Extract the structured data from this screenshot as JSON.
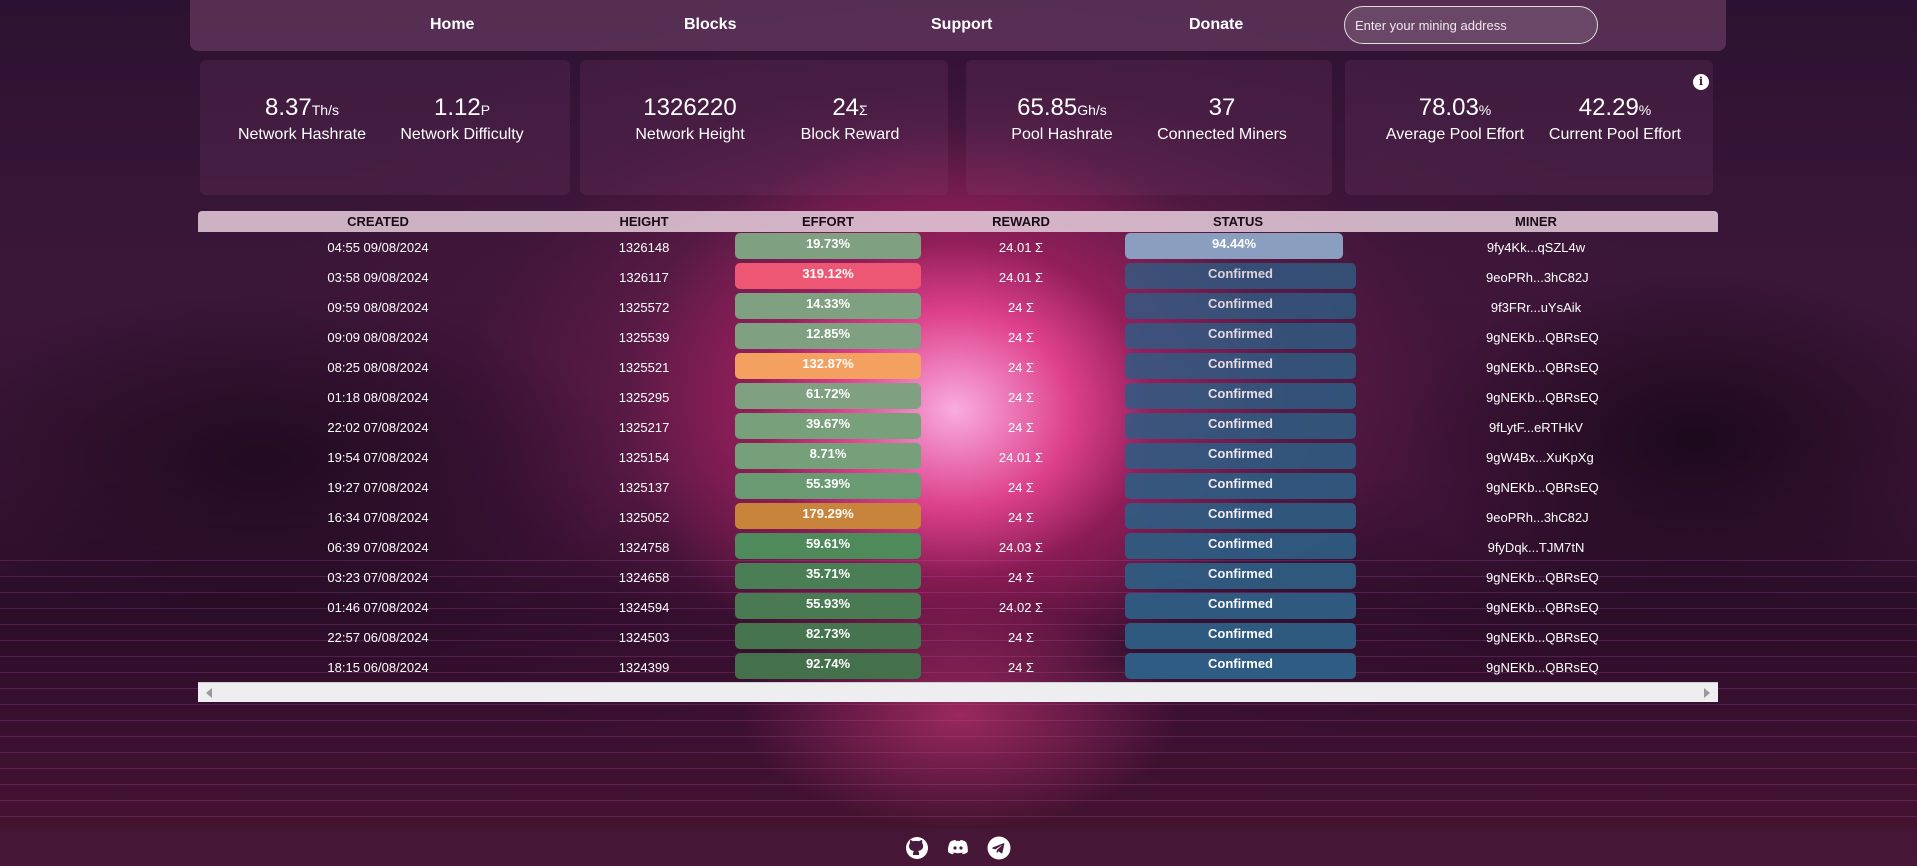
{
  "nav": {
    "links": [
      "Home",
      "Blocks",
      "Support",
      "Donate"
    ],
    "search_placeholder": "Enter your mining address"
  },
  "stats": [
    {
      "value": "8.37",
      "unit": "Th/s",
      "label": "Network Hashrate"
    },
    {
      "value": "1.12",
      "unit": "P",
      "label": "Network Difficulty"
    },
    {
      "value": "1326220",
      "unit": "",
      "label": "Network Height"
    },
    {
      "value": "24",
      "unit": "Σ",
      "label": "Block Reward"
    },
    {
      "value": "65.85",
      "unit": "Gh/s",
      "label": "Pool Hashrate"
    },
    {
      "value": "37",
      "unit": "",
      "label": "Connected Miners"
    },
    {
      "value": "78.03",
      "unit": "%",
      "label": "Average Pool Effort"
    },
    {
      "value": "42.29",
      "unit": "%",
      "label": "Current Pool Effort"
    }
  ],
  "info_icon": "i",
  "table": {
    "headers": [
      "CREATED",
      "HEIGHT",
      "EFFORT",
      "REWARD",
      "STATUS",
      "MINER"
    ],
    "rows": [
      {
        "created": "04:55 09/08/2024",
        "height": "1326148",
        "effort": "19.73%",
        "effort_color": "#7fa081",
        "reward": "24.01 Σ",
        "status": "94.44%",
        "status_pending": true,
        "miner": "9fy4Kk...qSZL4w"
      },
      {
        "created": "03:58 09/08/2024",
        "height": "1326117",
        "effort": "319.12%",
        "effort_color": "#ee5774",
        "reward": "24.01 Σ",
        "status": "Confirmed",
        "status_pending": false,
        "miner": "9eoPRh...3hC82J"
      },
      {
        "created": "09:59 08/08/2024",
        "height": "1325572",
        "effort": "14.33%",
        "effort_color": "#7fa081",
        "reward": "24 Σ",
        "status": "Confirmed",
        "status_pending": false,
        "miner": "9f3FRr...uYsAik"
      },
      {
        "created": "09:09 08/08/2024",
        "height": "1325539",
        "effort": "12.85%",
        "effort_color": "#7fa081",
        "reward": "24 Σ",
        "status": "Confirmed",
        "status_pending": false,
        "miner": "9gNEKb...QBRsEQ"
      },
      {
        "created": "08:25 08/08/2024",
        "height": "1325521",
        "effort": "132.87%",
        "effort_color": "#f4a060",
        "reward": "24 Σ",
        "status": "Confirmed",
        "status_pending": false,
        "miner": "9gNEKb...QBRsEQ"
      },
      {
        "created": "01:18 08/08/2024",
        "height": "1325295",
        "effort": "61.72%",
        "effort_color": "#7fa081",
        "reward": "24 Σ",
        "status": "Confirmed",
        "status_pending": false,
        "miner": "9gNEKb...QBRsEQ"
      },
      {
        "created": "22:02 07/08/2024",
        "height": "1325217",
        "effort": "39.67%",
        "effort_color": "#78a07a",
        "reward": "24 Σ",
        "status": "Confirmed",
        "status_pending": false,
        "miner": "9fLytF...eRTHkV"
      },
      {
        "created": "19:54 07/08/2024",
        "height": "1325154",
        "effort": "8.71%",
        "effort_color": "#75a07a",
        "reward": "24.01 Σ",
        "status": "Confirmed",
        "status_pending": false,
        "miner": "9gW4Bx...XuKpXg"
      },
      {
        "created": "19:27 07/08/2024",
        "height": "1325137",
        "effort": "55.39%",
        "effort_color": "#6a9a72",
        "reward": "24 Σ",
        "status": "Confirmed",
        "status_pending": false,
        "miner": "9gNEKb...QBRsEQ"
      },
      {
        "created": "16:34 07/08/2024",
        "height": "1325052",
        "effort": "179.29%",
        "effort_color": "#c8843a",
        "reward": "24 Σ",
        "status": "Confirmed",
        "status_pending": false,
        "miner": "9eoPRh...3hC82J"
      },
      {
        "created": "06:39 07/08/2024",
        "height": "1324758",
        "effort": "59.61%",
        "effort_color": "#4f8a5a",
        "reward": "24.03 Σ",
        "status": "Confirmed",
        "status_pending": false,
        "miner": "9fyDqk...TJM7tN"
      },
      {
        "created": "03:23 07/08/2024",
        "height": "1324658",
        "effort": "35.71%",
        "effort_color": "#4a7f55",
        "reward": "24 Σ",
        "status": "Confirmed",
        "status_pending": false,
        "miner": "9gNEKb...QBRsEQ"
      },
      {
        "created": "01:46 07/08/2024",
        "height": "1324594",
        "effort": "55.93%",
        "effort_color": "#4a7a52",
        "reward": "24.02 Σ",
        "status": "Confirmed",
        "status_pending": false,
        "miner": "9gNEKb...QBRsEQ"
      },
      {
        "created": "22:57 06/08/2024",
        "height": "1324503",
        "effort": "82.73%",
        "effort_color": "#46744e",
        "reward": "24 Σ",
        "status": "Confirmed",
        "status_pending": false,
        "miner": "9gNEKb...QBRsEQ"
      },
      {
        "created": "18:15 06/08/2024",
        "height": "1324399",
        "effort": "92.74%",
        "effort_color": "#44714c",
        "reward": "24 Σ",
        "status": "Confirmed",
        "status_pending": false,
        "miner": "9gNEKb...QBRsEQ"
      }
    ]
  },
  "footer": {
    "icons": [
      "github-icon",
      "discord-icon",
      "telegram-icon"
    ]
  },
  "colors": {
    "status_confirmed": "#2f5c82",
    "status_pending": "#8a9ec0"
  }
}
